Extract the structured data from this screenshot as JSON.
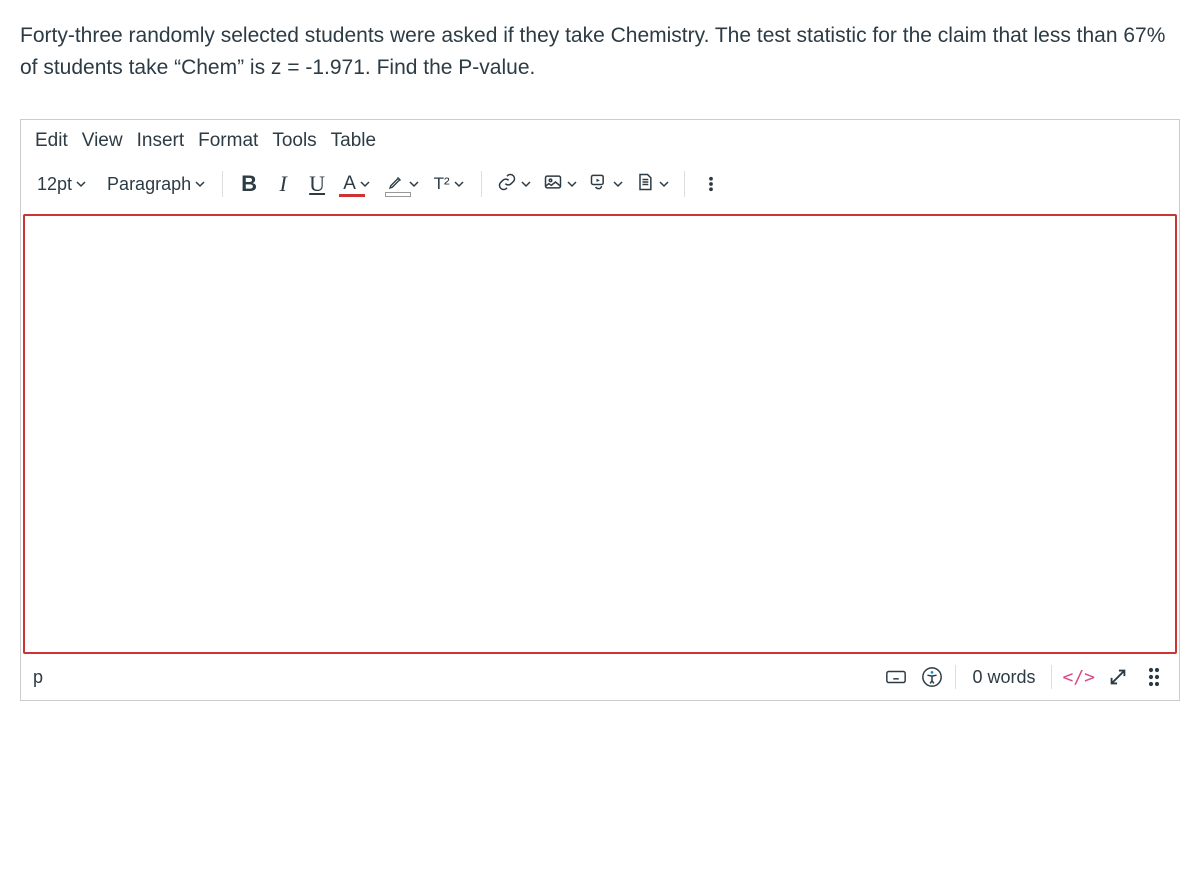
{
  "question": {
    "text": "Forty-three randomly selected students were asked if they take Chemistry. The test statistic for the claim that less than 67% of students take “Chem” is z = -1.971.  Find the P-value."
  },
  "menubar": {
    "edit": "Edit",
    "view": "View",
    "insert": "Insert",
    "format": "Format",
    "tools": "Tools",
    "table": "Table"
  },
  "toolbar": {
    "font_size": "12pt",
    "block_format": "Paragraph",
    "bold": "B",
    "italic": "I",
    "underline": "U",
    "text_color": "A",
    "superscript": "T²"
  },
  "statusbar": {
    "path": "p",
    "word_count": "0 words",
    "html_toggle": "</>"
  }
}
